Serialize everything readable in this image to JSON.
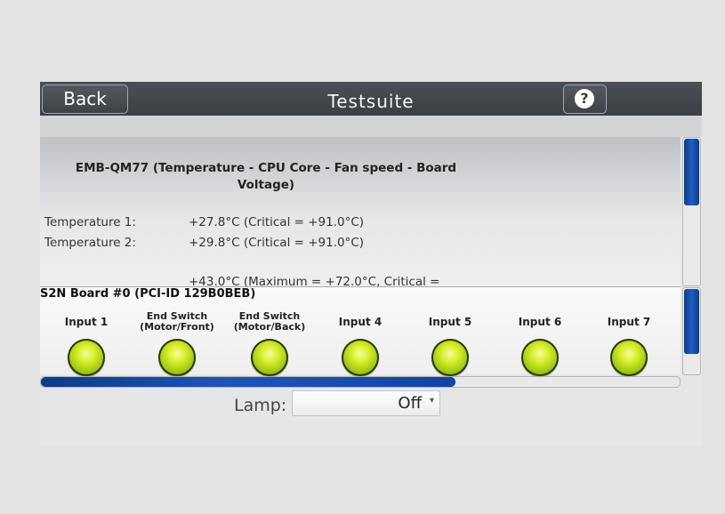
{
  "header": {
    "back_label": "Back",
    "title": "Testsuite",
    "help_icon": "?"
  },
  "info": {
    "title_line1": "EMB-QM77 (Temperature - CPU Core - Fan speed - Board",
    "title_line2": "Voltage)",
    "temps": [
      {
        "label": "Temperature 1:",
        "value": "+27.8°C (Critical = +91.0°C)"
      },
      {
        "label": "Temperature 2:",
        "value": "+29.8°C (Critical = +91.0°C)"
      }
    ],
    "partial_line": "+43.0°C (Maximum = +72.0°C, Critical ="
  },
  "io": {
    "board_title": "S2N Board #0 (PCI-ID 129B0BEB)",
    "inputs": [
      {
        "l1": "Input 1",
        "l2": ""
      },
      {
        "l1": "End Switch",
        "l2": "(Motor/Front)"
      },
      {
        "l1": "End Switch",
        "l2": "(Motor/Back)"
      },
      {
        "l1": "Input 4",
        "l2": ""
      },
      {
        "l1": "Input 5",
        "l2": ""
      },
      {
        "l1": "Input 6",
        "l2": ""
      },
      {
        "l1": "Input 7",
        "l2": ""
      }
    ]
  },
  "lamp": {
    "label": "Lamp:",
    "value": "Off",
    "arrow": "▾"
  },
  "colors": {
    "titlebar": "#3b4045",
    "accent": "#1d5fc0",
    "led": "#c8e31c"
  }
}
